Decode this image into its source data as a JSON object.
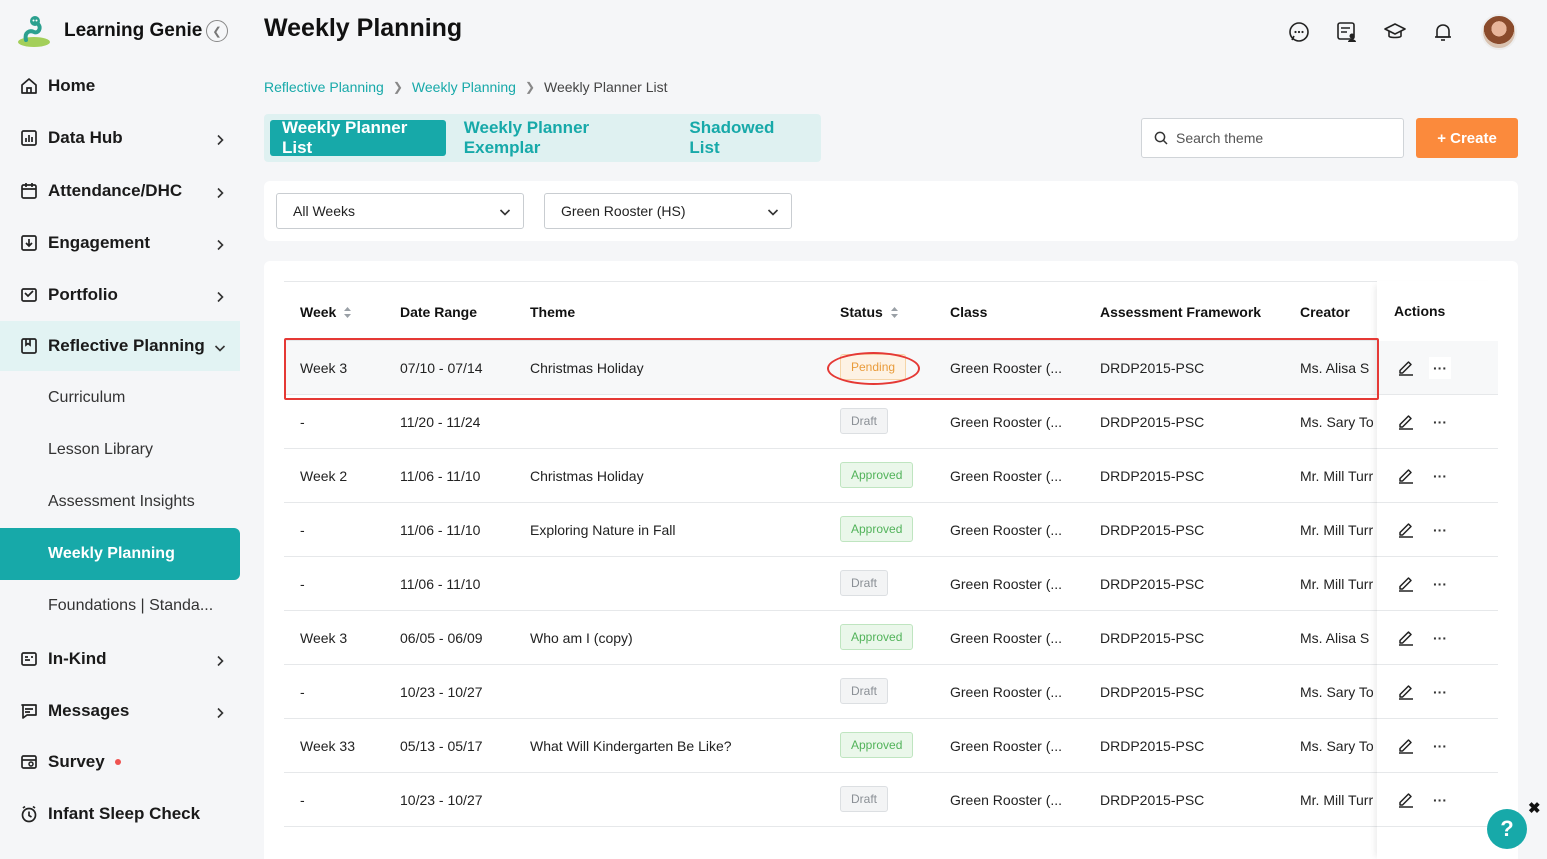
{
  "app": {
    "name": "Learning Genie"
  },
  "sidebar": {
    "items": [
      {
        "label": "Home",
        "icon": "home-icon",
        "has_chevron": false
      },
      {
        "label": "Data Hub",
        "icon": "chart-icon",
        "has_chevron": true
      },
      {
        "label": "Attendance/DHC",
        "icon": "calendar-icon",
        "has_chevron": true
      },
      {
        "label": "Engagement",
        "icon": "engagement-icon",
        "has_chevron": true
      },
      {
        "label": "Portfolio",
        "icon": "portfolio-icon",
        "has_chevron": true
      },
      {
        "label": "Reflective Planning",
        "icon": "planning-icon",
        "has_chevron": true,
        "expanded": true
      },
      {
        "label": "In-Kind",
        "icon": "inkind-icon",
        "has_chevron": true
      },
      {
        "label": "Messages",
        "icon": "message-icon",
        "has_chevron": true
      },
      {
        "label": "Survey",
        "icon": "survey-icon",
        "has_chevron": false,
        "has_dot": true
      },
      {
        "label": "Infant Sleep Check",
        "icon": "clock-icon",
        "has_chevron": false
      }
    ],
    "subitems": [
      {
        "label": "Curriculum"
      },
      {
        "label": "Lesson Library"
      },
      {
        "label": "Assessment Insights"
      },
      {
        "label": "Weekly Planning",
        "active": true
      },
      {
        "label": "Foundations | Standa..."
      }
    ]
  },
  "header": {
    "title": "Weekly Planning",
    "icons": [
      "chat-icon",
      "list-user-icon",
      "graduation-cap-icon",
      "bell-icon"
    ]
  },
  "breadcrumb": {
    "items": [
      "Reflective Planning",
      "Weekly Planning",
      "Weekly Planner List"
    ]
  },
  "tabs": [
    {
      "label": "Weekly Planner List",
      "active": true
    },
    {
      "label": "Weekly Planner Exemplar"
    },
    {
      "label": "Shadowed List"
    }
  ],
  "search": {
    "placeholder": "Search theme",
    "value": ""
  },
  "create_button": {
    "label": "+ Create"
  },
  "filters": {
    "week": "All Weeks",
    "class": "Green Rooster (HS)"
  },
  "table": {
    "headers": {
      "week": "Week",
      "date_range": "Date Range",
      "theme": "Theme",
      "status": "Status",
      "class": "Class",
      "framework": "Assessment Framework",
      "creator": "Creator",
      "actions": "Actions"
    },
    "rows": [
      {
        "week": "Week 3",
        "date_range": "07/10 - 07/14",
        "theme": "Christmas Holiday",
        "status": "Pending",
        "class": "Green Rooster (...",
        "framework": "DRDP2015-PSC",
        "creator": "Ms. Alisa S"
      },
      {
        "week": "-",
        "date_range": "11/20 - 11/24",
        "theme": "",
        "status": "Draft",
        "class": "Green Rooster (...",
        "framework": "DRDP2015-PSC",
        "creator": "Ms. Sary To"
      },
      {
        "week": "Week 2",
        "date_range": "11/06 - 11/10",
        "theme": "Christmas Holiday",
        "status": "Approved",
        "class": "Green Rooster (...",
        "framework": "DRDP2015-PSC",
        "creator": "Mr. Mill Turr"
      },
      {
        "week": "-",
        "date_range": "11/06 - 11/10",
        "theme": "Exploring Nature in Fall",
        "status": "Approved",
        "class": "Green Rooster (...",
        "framework": "DRDP2015-PSC",
        "creator": "Mr. Mill Turr"
      },
      {
        "week": "-",
        "date_range": "11/06 - 11/10",
        "theme": "",
        "status": "Draft",
        "class": "Green Rooster (...",
        "framework": "DRDP2015-PSC",
        "creator": "Mr. Mill Turr"
      },
      {
        "week": "Week 3",
        "date_range": "06/05 - 06/09",
        "theme": "Who am I (copy)",
        "status": "Approved",
        "class": "Green Rooster (...",
        "framework": "DRDP2015-PSC",
        "creator": "Ms. Alisa S"
      },
      {
        "week": "-",
        "date_range": "10/23 - 10/27",
        "theme": "",
        "status": "Draft",
        "class": "Green Rooster (...",
        "framework": "DRDP2015-PSC",
        "creator": "Ms. Sary To"
      },
      {
        "week": "Week 33",
        "date_range": "05/13 - 05/17",
        "theme": "What Will Kindergarten Be Like?",
        "status": "Approved",
        "class": "Green Rooster (...",
        "framework": "DRDP2015-PSC",
        "creator": "Ms. Sary To"
      },
      {
        "week": "-",
        "date_range": "10/23 - 10/27",
        "theme": "",
        "status": "Draft",
        "class": "Green Rooster (...",
        "framework": "DRDP2015-PSC",
        "creator": "Mr. Mill Turr"
      }
    ]
  },
  "help": {
    "label": "?",
    "close": "✖"
  },
  "colors": {
    "accent": "#17a9a9",
    "create": "#fb8a3c",
    "highlight": "#e53935"
  }
}
